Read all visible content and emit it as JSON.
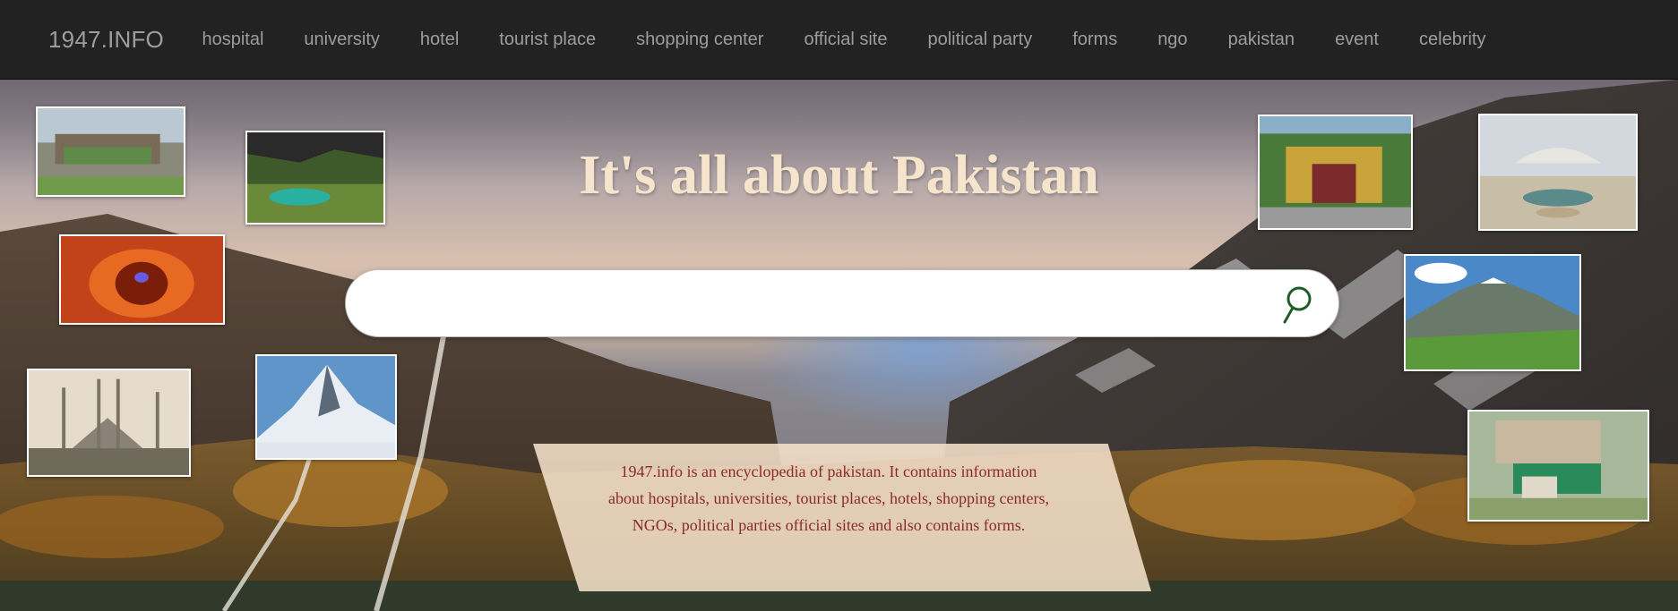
{
  "navbar": {
    "brand": "1947.INFO",
    "links": [
      {
        "label": "hospital"
      },
      {
        "label": "university"
      },
      {
        "label": "hotel"
      },
      {
        "label": "tourist place"
      },
      {
        "label": "shopping center"
      },
      {
        "label": "official site"
      },
      {
        "label": "political party"
      },
      {
        "label": "forms"
      },
      {
        "label": "ngo"
      },
      {
        "label": "pakistan"
      },
      {
        "label": "event"
      },
      {
        "label": "celebrity"
      }
    ]
  },
  "hero": {
    "title": "It's all about Pakistan",
    "search": {
      "value": "",
      "placeholder": "",
      "icon": "search-icon",
      "icon_color": "#1f5c2a"
    },
    "info_text": "1947.info is an encyclopedia of pakistan. It contains information about hospitals, universities, tourist places, hotels, shopping centers, NGOs, political parties official sites and also contains forms."
  },
  "colors": {
    "navbar_bg": "#222222",
    "nav_text": "#9d9d9d",
    "title": "#f7e4cc",
    "info_bg": "#f4e0ca",
    "info_text": "#8b2a2a"
  }
}
